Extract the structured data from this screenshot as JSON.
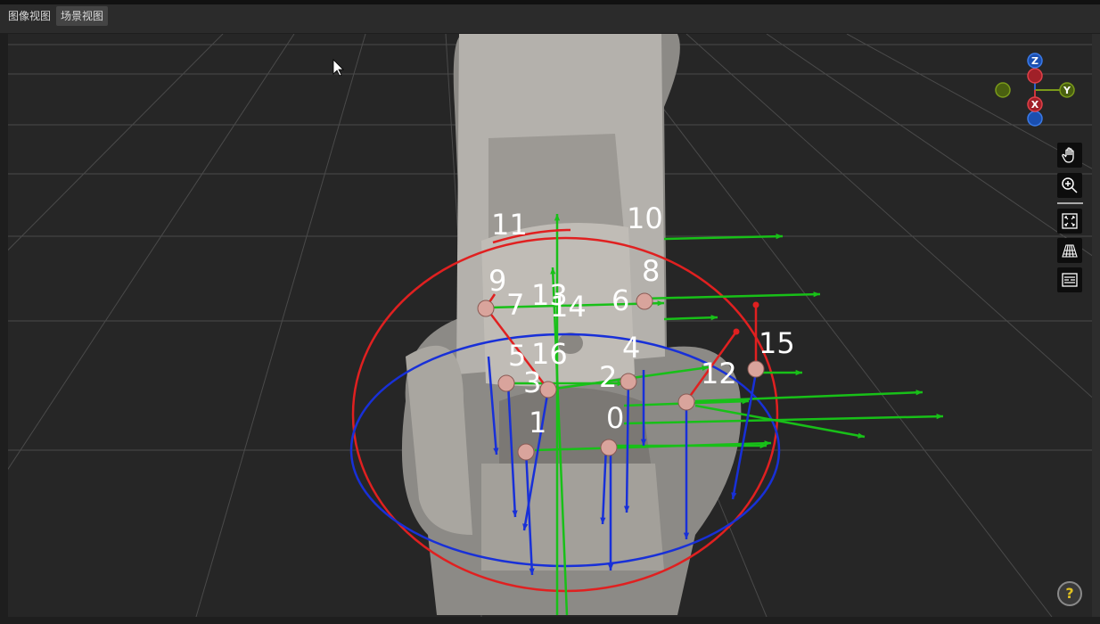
{
  "tabs": [
    {
      "label": "图像视图",
      "active": false
    },
    {
      "label": "场景视图",
      "active": true
    }
  ],
  "gizmo": {
    "z_label": "Z",
    "y_label": "Y",
    "x_label": "X",
    "colors": {
      "x": "#d0343c",
      "y": "#7a9a1a",
      "z": "#2a62c8"
    }
  },
  "toolbar": [
    {
      "icon": "hand-pan-icon"
    },
    {
      "icon": "zoom-in-icon"
    },
    {
      "icon": "fit-view-icon"
    },
    {
      "icon": "grid-floor-icon"
    },
    {
      "icon": "list-panel-icon"
    }
  ],
  "help_label": "?",
  "scene": {
    "point_labels": [
      "0",
      "1",
      "2",
      "3",
      "4",
      "5",
      "6",
      "7",
      "8",
      "9",
      "10",
      "11",
      "12",
      "13",
      "14",
      "15",
      "16"
    ],
    "axis_colors": {
      "x": "#e02020",
      "y": "#18c018",
      "z": "#1830d8"
    }
  }
}
